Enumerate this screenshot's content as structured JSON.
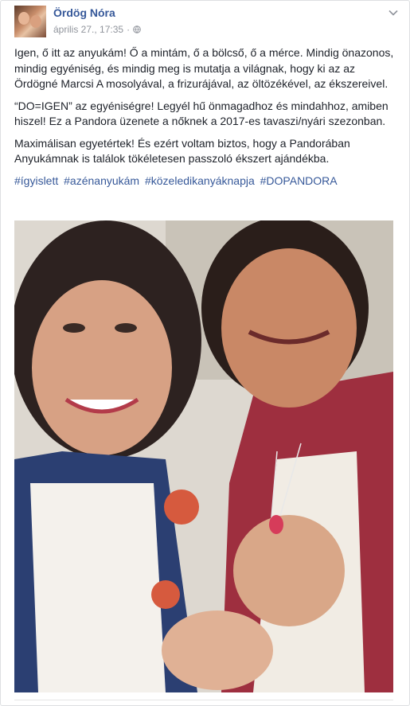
{
  "post": {
    "author": "Ördög Nóra",
    "timestamp": "április 27., 17:35",
    "separator": "·",
    "privacy_icon": "globe-icon",
    "menu_icon": "chevron-down-icon",
    "paragraphs": [
      "Igen, ő itt az anyukám! Ő a mintám, ő a bölcső, ő a mérce. Mindig önazonos, mindig egyéniség, és mindig meg is mutatja a világnak, hogy ki az az Ördögné Marcsi A mosolyával, a frizurájával, az öltözékével, az ékszereivel.",
      "“DO=IGEN” az egyéniségre! Legyél hű önmagadhoz és mindahhoz, amiben hiszel! Ez a Pandora üzenete a nőknek a 2017-es tavaszi/nyári szezonban.",
      "Maximálisan egyetértek! És ezért voltam biztos, hogy a Pandorában Anyukámnak is találok tökéletesen passzoló ékszert ajándékba."
    ],
    "hashtags": [
      "#ígyislett",
      "#azénanyukám",
      "#közeledikanyáknapja",
      "#DOPANDORA"
    ]
  },
  "colors": {
    "link": "#365899",
    "meta": "#90949c",
    "text": "#1d2129"
  }
}
